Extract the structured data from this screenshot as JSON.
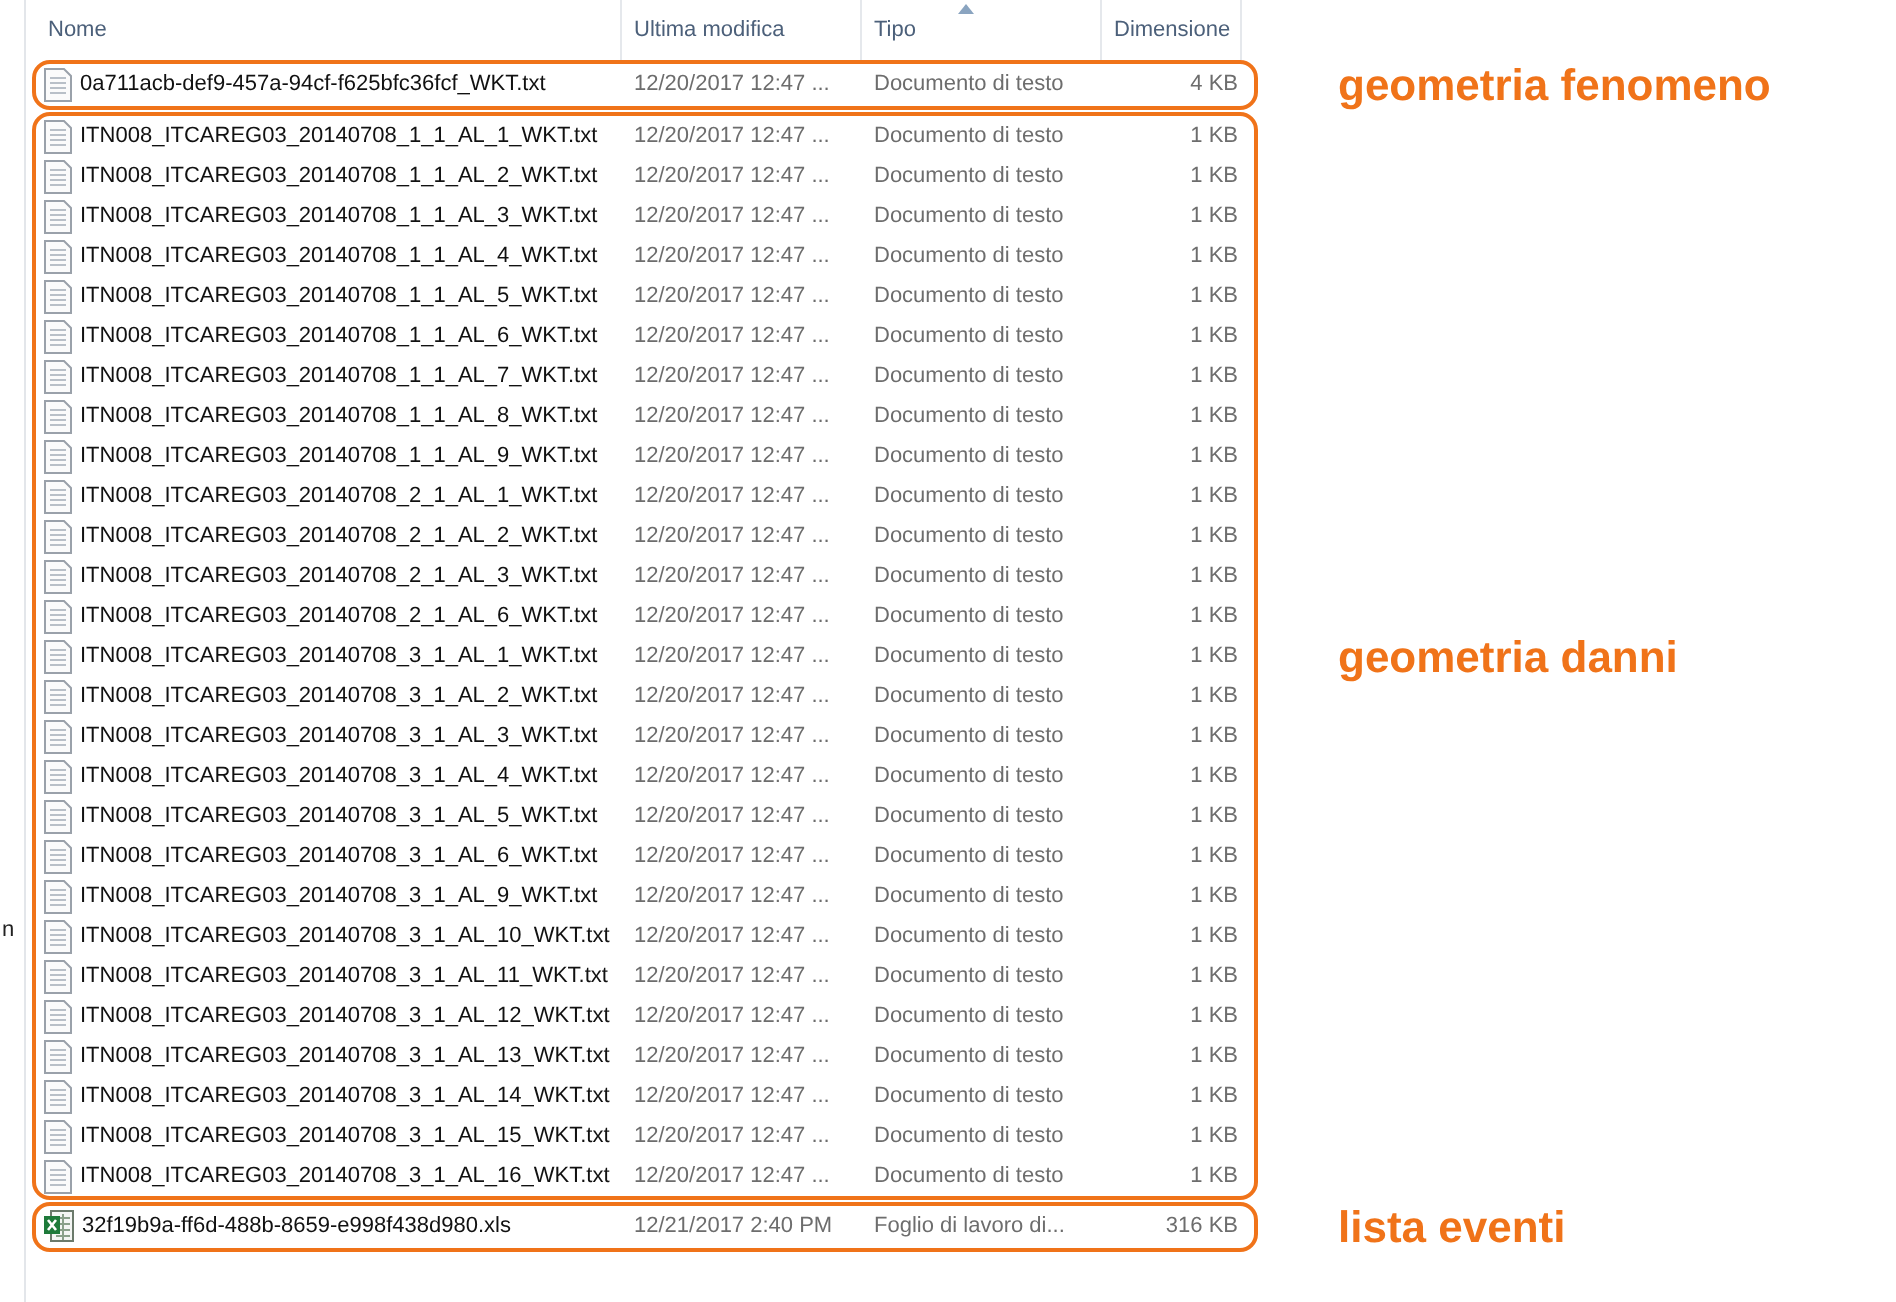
{
  "left_pane_fragment": "n",
  "columns": [
    {
      "label": "Nome",
      "sorted": false
    },
    {
      "label": "Ultima modifica",
      "sorted": false
    },
    {
      "label": "Tipo",
      "sorted": true
    },
    {
      "label": "Dimensione",
      "sorted": false
    }
  ],
  "groups": [
    {
      "annotation": "geometria fenomeno",
      "files": [
        {
          "kind": "text",
          "name": "0a711acb-def9-457a-94cf-f625bfc36fcf_WKT.txt",
          "modified": "12/20/2017 12:47 ...",
          "type": "Documento di testo",
          "size": "4 KB"
        }
      ]
    },
    {
      "annotation": "geometria danni",
      "files": [
        {
          "kind": "text",
          "name": "ITN008_ITCAREG03_20140708_1_1_AL_1_WKT.txt",
          "modified": "12/20/2017 12:47 ...",
          "type": "Documento di testo",
          "size": "1 KB"
        },
        {
          "kind": "text",
          "name": "ITN008_ITCAREG03_20140708_1_1_AL_2_WKT.txt",
          "modified": "12/20/2017 12:47 ...",
          "type": "Documento di testo",
          "size": "1 KB"
        },
        {
          "kind": "text",
          "name": "ITN008_ITCAREG03_20140708_1_1_AL_3_WKT.txt",
          "modified": "12/20/2017 12:47 ...",
          "type": "Documento di testo",
          "size": "1 KB"
        },
        {
          "kind": "text",
          "name": "ITN008_ITCAREG03_20140708_1_1_AL_4_WKT.txt",
          "modified": "12/20/2017 12:47 ...",
          "type": "Documento di testo",
          "size": "1 KB"
        },
        {
          "kind": "text",
          "name": "ITN008_ITCAREG03_20140708_1_1_AL_5_WKT.txt",
          "modified": "12/20/2017 12:47 ...",
          "type": "Documento di testo",
          "size": "1 KB"
        },
        {
          "kind": "text",
          "name": "ITN008_ITCAREG03_20140708_1_1_AL_6_WKT.txt",
          "modified": "12/20/2017 12:47 ...",
          "type": "Documento di testo",
          "size": "1 KB"
        },
        {
          "kind": "text",
          "name": "ITN008_ITCAREG03_20140708_1_1_AL_7_WKT.txt",
          "modified": "12/20/2017 12:47 ...",
          "type": "Documento di testo",
          "size": "1 KB"
        },
        {
          "kind": "text",
          "name": "ITN008_ITCAREG03_20140708_1_1_AL_8_WKT.txt",
          "modified": "12/20/2017 12:47 ...",
          "type": "Documento di testo",
          "size": "1 KB"
        },
        {
          "kind": "text",
          "name": "ITN008_ITCAREG03_20140708_1_1_AL_9_WKT.txt",
          "modified": "12/20/2017 12:47 ...",
          "type": "Documento di testo",
          "size": "1 KB"
        },
        {
          "kind": "text",
          "name": "ITN008_ITCAREG03_20140708_2_1_AL_1_WKT.txt",
          "modified": "12/20/2017 12:47 ...",
          "type": "Documento di testo",
          "size": "1 KB"
        },
        {
          "kind": "text",
          "name": "ITN008_ITCAREG03_20140708_2_1_AL_2_WKT.txt",
          "modified": "12/20/2017 12:47 ...",
          "type": "Documento di testo",
          "size": "1 KB"
        },
        {
          "kind": "text",
          "name": "ITN008_ITCAREG03_20140708_2_1_AL_3_WKT.txt",
          "modified": "12/20/2017 12:47 ...",
          "type": "Documento di testo",
          "size": "1 KB"
        },
        {
          "kind": "text",
          "name": "ITN008_ITCAREG03_20140708_2_1_AL_6_WKT.txt",
          "modified": "12/20/2017 12:47 ...",
          "type": "Documento di testo",
          "size": "1 KB"
        },
        {
          "kind": "text",
          "name": "ITN008_ITCAREG03_20140708_3_1_AL_1_WKT.txt",
          "modified": "12/20/2017 12:47 ...",
          "type": "Documento di testo",
          "size": "1 KB"
        },
        {
          "kind": "text",
          "name": "ITN008_ITCAREG03_20140708_3_1_AL_2_WKT.txt",
          "modified": "12/20/2017 12:47 ...",
          "type": "Documento di testo",
          "size": "1 KB"
        },
        {
          "kind": "text",
          "name": "ITN008_ITCAREG03_20140708_3_1_AL_3_WKT.txt",
          "modified": "12/20/2017 12:47 ...",
          "type": "Documento di testo",
          "size": "1 KB"
        },
        {
          "kind": "text",
          "name": "ITN008_ITCAREG03_20140708_3_1_AL_4_WKT.txt",
          "modified": "12/20/2017 12:47 ...",
          "type": "Documento di testo",
          "size": "1 KB"
        },
        {
          "kind": "text",
          "name": "ITN008_ITCAREG03_20140708_3_1_AL_5_WKT.txt",
          "modified": "12/20/2017 12:47 ...",
          "type": "Documento di testo",
          "size": "1 KB"
        },
        {
          "kind": "text",
          "name": "ITN008_ITCAREG03_20140708_3_1_AL_6_WKT.txt",
          "modified": "12/20/2017 12:47 ...",
          "type": "Documento di testo",
          "size": "1 KB"
        },
        {
          "kind": "text",
          "name": "ITN008_ITCAREG03_20140708_3_1_AL_9_WKT.txt",
          "modified": "12/20/2017 12:47 ...",
          "type": "Documento di testo",
          "size": "1 KB"
        },
        {
          "kind": "text",
          "name": "ITN008_ITCAREG03_20140708_3_1_AL_10_WKT.txt",
          "modified": "12/20/2017 12:47 ...",
          "type": "Documento di testo",
          "size": "1 KB"
        },
        {
          "kind": "text",
          "name": "ITN008_ITCAREG03_20140708_3_1_AL_11_WKT.txt",
          "modified": "12/20/2017 12:47 ...",
          "type": "Documento di testo",
          "size": "1 KB"
        },
        {
          "kind": "text",
          "name": "ITN008_ITCAREG03_20140708_3_1_AL_12_WKT.txt",
          "modified": "12/20/2017 12:47 ...",
          "type": "Documento di testo",
          "size": "1 KB"
        },
        {
          "kind": "text",
          "name": "ITN008_ITCAREG03_20140708_3_1_AL_13_WKT.txt",
          "modified": "12/20/2017 12:47 ...",
          "type": "Documento di testo",
          "size": "1 KB"
        },
        {
          "kind": "text",
          "name": "ITN008_ITCAREG03_20140708_3_1_AL_14_WKT.txt",
          "modified": "12/20/2017 12:47 ...",
          "type": "Documento di testo",
          "size": "1 KB"
        },
        {
          "kind": "text",
          "name": "ITN008_ITCAREG03_20140708_3_1_AL_15_WKT.txt",
          "modified": "12/20/2017 12:47 ...",
          "type": "Documento di testo",
          "size": "1 KB"
        },
        {
          "kind": "text",
          "name": "ITN008_ITCAREG03_20140708_3_1_AL_16_WKT.txt",
          "modified": "12/20/2017 12:47 ...",
          "type": "Documento di testo",
          "size": "1 KB"
        }
      ]
    },
    {
      "annotation": "lista eventi",
      "files": [
        {
          "kind": "spreadsheet",
          "name": "32f19b9a-ff6d-488b-8659-e998f438d980.xls",
          "modified": "12/21/2017 2:40 PM",
          "type": "Foglio di lavoro di...",
          "size": "316 KB"
        }
      ]
    }
  ]
}
